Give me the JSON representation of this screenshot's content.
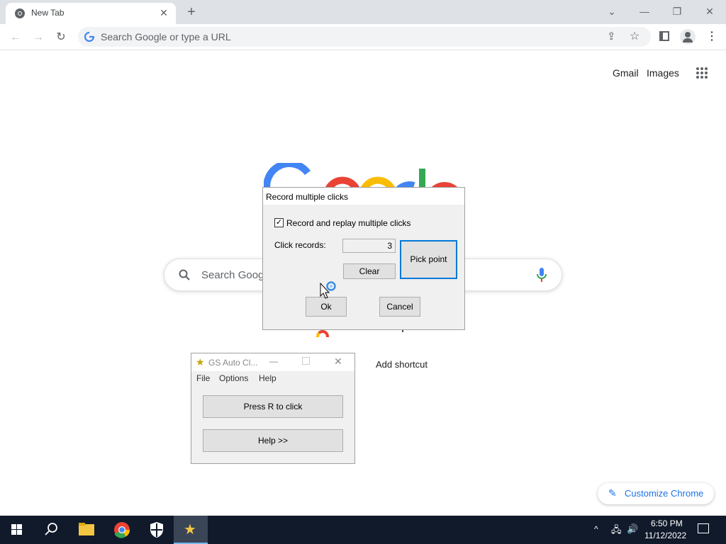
{
  "browser": {
    "tab_title": "New Tab",
    "omnibox_placeholder": "Search Google or type a URL"
  },
  "page": {
    "gmail": "Gmail",
    "images": "Images",
    "search_placeholder": "Search Goog",
    "add_shortcut": "Add shortcut",
    "customize": "Customize Chrome"
  },
  "dialog": {
    "title": "Record multiple clicks",
    "checkbox_label": "Record and replay multiple clicks",
    "click_records_label": "Click records:",
    "click_records_value": "3",
    "clear": "Clear",
    "pick_point": "Pick point",
    "ok": "Ok",
    "cancel": "Cancel"
  },
  "autoclicker": {
    "title": "GS Auto Cl...",
    "menu": [
      "File",
      "Options",
      "Help"
    ],
    "press_r": "Press R to click",
    "help": "Help >>"
  },
  "taskbar": {
    "time": "6:50 PM",
    "date": "11/12/2022"
  },
  "colors": {
    "google_blue": "#4285f4",
    "google_red": "#ea4335",
    "google_yellow": "#fbbc05",
    "google_green": "#34a853",
    "taskbar": "#101a2b"
  }
}
